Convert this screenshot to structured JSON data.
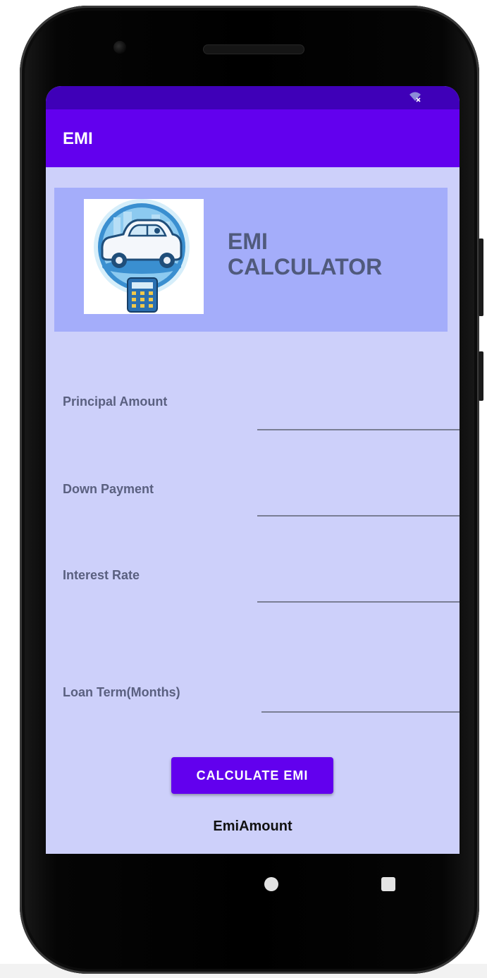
{
  "app": {
    "title": "EMI"
  },
  "header": {
    "title_line1": "EMI",
    "title_line2": "CALCULATOR",
    "logo_icon": "car-calculator-logo"
  },
  "fields": {
    "principal": {
      "label": "Principal Amount",
      "value": ""
    },
    "down_payment": {
      "label": "Down Payment",
      "value": ""
    },
    "interest_rate": {
      "label": "Interest Rate",
      "value": ""
    },
    "loan_term": {
      "label": "Loan Term(Months)",
      "value": ""
    }
  },
  "actions": {
    "calculate_label": "CALCULATE EMI"
  },
  "result": {
    "emi_amount_label": "EmiAmount"
  },
  "colors": {
    "status_bar": "#3f00b8",
    "app_bar": "#6200ee",
    "screen_background": "#cdd0fa",
    "header_card": "#a4adfa",
    "button": "#6200ee"
  },
  "icons": {
    "status": "wifi-icon",
    "nav_home": "home-icon",
    "nav_recents": "recents-icon"
  }
}
